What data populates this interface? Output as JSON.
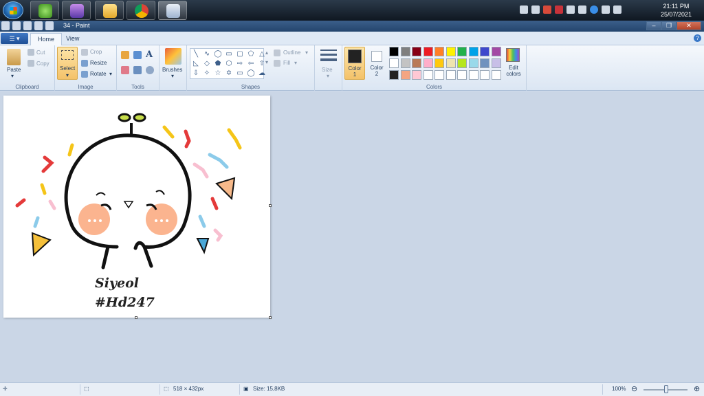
{
  "window": {
    "title": "34 - Paint"
  },
  "clock": {
    "time": "21:11 PM",
    "date": "25/07/2021"
  },
  "tabs": [
    {
      "label": "Home"
    },
    {
      "label": "View"
    }
  ],
  "ribbon": {
    "clipboard": {
      "paste": "Paste",
      "cut": "Cut",
      "copy": "Copy",
      "label": "Clipboard"
    },
    "image": {
      "select": "Select",
      "crop": "Crop",
      "resize": "Resize",
      "rotate": "Rotate",
      "label": "Image"
    },
    "tools": {
      "label": "Tools"
    },
    "brushes": {
      "label": "Brushes"
    },
    "shapes": {
      "label": "Shapes",
      "outline": "Outline",
      "fill": "Fill"
    },
    "size": {
      "label": "Size"
    },
    "colors": {
      "color1": "Color 1",
      "color2": "Color 2",
      "edit": "Edit colors",
      "label": "Colors",
      "color1_value": "#222222",
      "color2_value": "#ffffff",
      "palette": [
        "#000000",
        "#7f7f7f",
        "#880015",
        "#ed1c24",
        "#ff7f27",
        "#fff200",
        "#22b14c",
        "#00a2e8",
        "#3f48cc",
        "#a349a4",
        "#ffffff",
        "#c3c3c3",
        "#b97a57",
        "#ffaec9",
        "#ffc90e",
        "#efe4b0",
        "#b5e61d",
        "#99d9ea",
        "#7092be",
        "#c8bfe7",
        "#222222",
        "#f4a582",
        "#ffc8d4",
        "#ffffff",
        "#ffffff",
        "#ffffff",
        "#ffffff",
        "#ffffff",
        "#ffffff",
        "#ffffff"
      ]
    }
  },
  "canvas": {
    "text_line1": "Siyeol",
    "text_line2": "#Hd247"
  },
  "status": {
    "dimensions": "518 × 432px",
    "size": "Size: 15,8KB",
    "zoom": "100%"
  }
}
